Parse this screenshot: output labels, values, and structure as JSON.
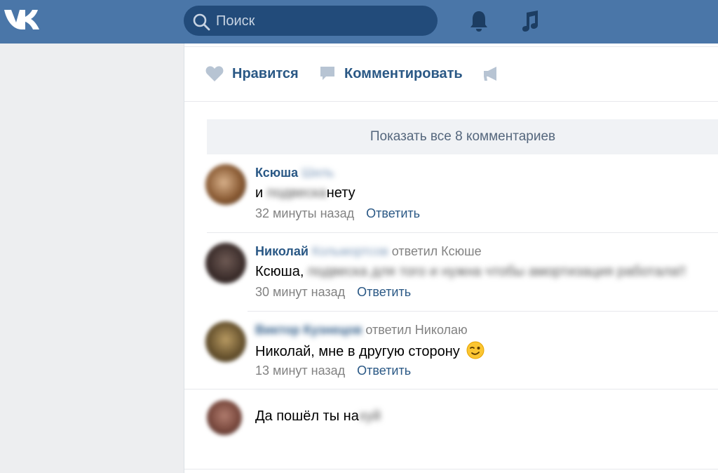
{
  "header": {
    "logo": "vk-logo",
    "search_placeholder": "Поиск",
    "icons": [
      "search-icon",
      "bell-icon",
      "music-icon"
    ],
    "bg_color": "#4a76a8"
  },
  "post_actions": {
    "like_label": "Нравится",
    "comment_label": "Комментировать",
    "share_icon": "megaphone-icon"
  },
  "show_all_label": "Показать все 8 комментариев",
  "comments": [
    {
      "author": "Ксюша",
      "author_blurred": "Шиль",
      "text_prefix": "и",
      "text_blurred": "подвеска",
      "text_suffix": "нету",
      "time": "32 минуты назад",
      "reply_label": "Ответить"
    },
    {
      "author": "Николай",
      "author_blurred": "Кольмортсов",
      "replied_to": "ответил Ксюше",
      "text_prefix": "Ксюша,",
      "text_blurred": "подвеска для того и нужна чтобы амортизация работала!!",
      "time": "30 минут назад",
      "reply_label": "Ответить"
    },
    {
      "author_blurred": "Виктор Кузнецов",
      "replied_to": "ответил Николаю",
      "text_prefix": "Николай, мне в другую сторону",
      "emoji": "winking-face-emoji",
      "time": "13 минут назад",
      "reply_label": "Ответить"
    }
  ],
  "composer": {
    "draft_prefix": "Да пошёл ты на",
    "draft_blurred": "хуй"
  },
  "colors": {
    "link": "#2a5885",
    "muted": "#828282",
    "page_bg": "#edeef0"
  }
}
